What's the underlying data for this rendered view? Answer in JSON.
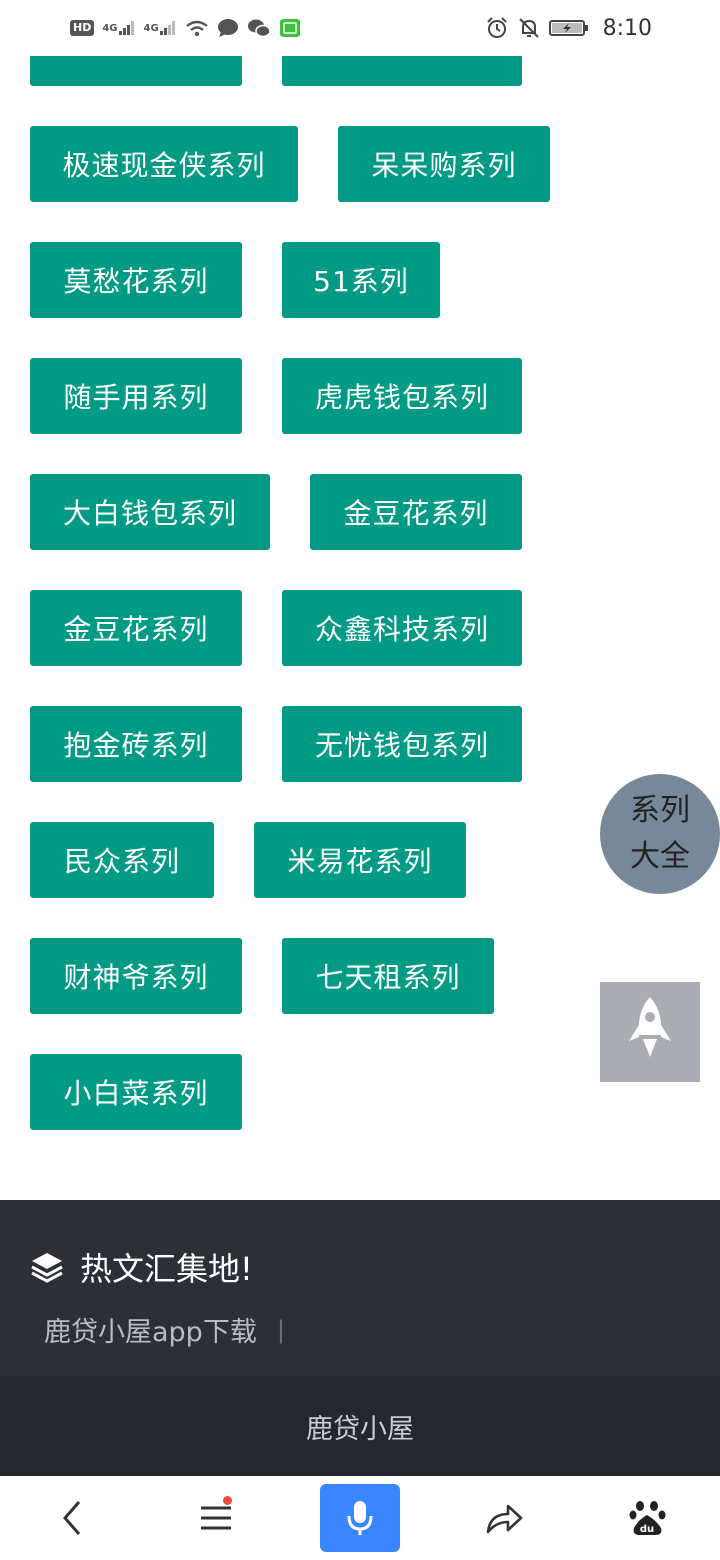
{
  "status_bar": {
    "hd": "HD",
    "sim1": "4G",
    "sim2": "4G",
    "time": "8:10"
  },
  "series_buttons": [
    {
      "label": ""
    },
    {
      "label": ""
    },
    {
      "label": "极速现金侠系列"
    },
    {
      "label": "呆呆购系列"
    },
    {
      "label": "莫愁花系列"
    },
    {
      "label": "51系列"
    },
    {
      "label": "随手用系列"
    },
    {
      "label": "虎虎钱包系列"
    },
    {
      "label": "大白钱包系列"
    },
    {
      "label": "金豆花系列"
    },
    {
      "label": "金豆花系列"
    },
    {
      "label": "众鑫科技系列"
    },
    {
      "label": "抱金砖系列"
    },
    {
      "label": "无忧钱包系列"
    },
    {
      "label": "民众系列"
    },
    {
      "label": "米易花系列"
    },
    {
      "label": "财神爷系列"
    },
    {
      "label": "七天租系列"
    },
    {
      "label": "小白菜系列"
    }
  ],
  "floating": {
    "series_line1": "系列",
    "series_line2": "大全",
    "rocket_icon": "rocket-icon"
  },
  "footer": {
    "title": "热文汇集地!",
    "link": "鹿贷小屋app下载",
    "separator": "|",
    "copyright": "鹿贷小屋"
  },
  "nav": {
    "back_icon": "back-icon",
    "menu_icon": "menu-icon",
    "mic_icon": "mic-icon",
    "share_icon": "share-icon",
    "baidu_icon": "baidu-icon"
  },
  "colors": {
    "button_bg": "#009a85",
    "footer_bg": "#2c2f37",
    "mic_bg": "#3a86ff"
  }
}
